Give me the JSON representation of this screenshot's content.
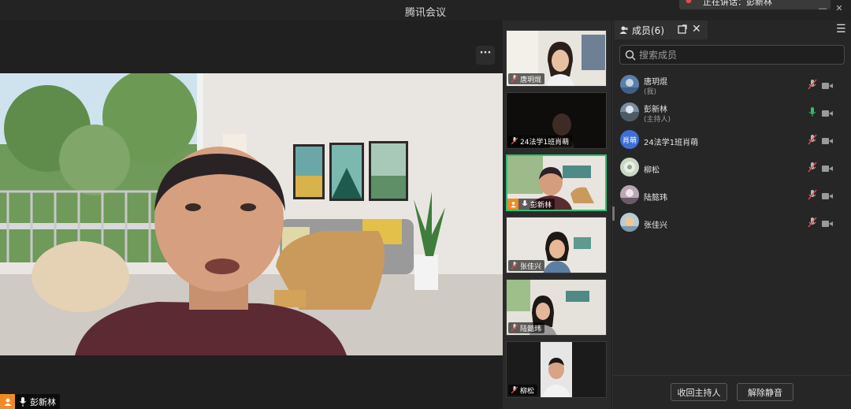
{
  "window": {
    "title": "腾讯会议"
  },
  "speaking_toast": "正在讲话：彭新林",
  "main_speaker": {
    "name": "彭新林"
  },
  "more_button": "···",
  "thumbnails": [
    {
      "name": "唐玥焜"
    },
    {
      "name": "24法学1班肖萌"
    },
    {
      "name": "彭新林"
    },
    {
      "name": "张佳兴"
    },
    {
      "name": "陆懿玮"
    },
    {
      "name": "柳松"
    }
  ],
  "panel": {
    "tab_label": "成员(6)",
    "search_placeholder": "搜索成员",
    "members": [
      {
        "name": "唐玥焜",
        "role": "(我)",
        "mic": "muted",
        "avatar_color": "#5b7fa8"
      },
      {
        "name": "彭新林",
        "role": "(主持人)",
        "mic": "on",
        "avatar_color": "#7a8ea0"
      },
      {
        "name": "24法学1班肖萌",
        "role": "",
        "mic": "muted",
        "avatar_text": "肖萌",
        "avatar_color": "#3d6fd6"
      },
      {
        "name": "柳松",
        "role": "",
        "mic": "muted",
        "avatar_color": "#c9d8c2"
      },
      {
        "name": "陆懿玮",
        "role": "",
        "mic": "muted",
        "avatar_color": "#b9a7b6"
      },
      {
        "name": "张佳兴",
        "role": "",
        "mic": "muted",
        "avatar_color": "#b8cbd6"
      }
    ],
    "reclaim_host_label": "收回主持人",
    "unmute_all_label": "解除静音"
  },
  "colors": {
    "accent_green": "#2fbf71",
    "host_orange": "#f08a24",
    "muted_red": "#e04b4b"
  }
}
